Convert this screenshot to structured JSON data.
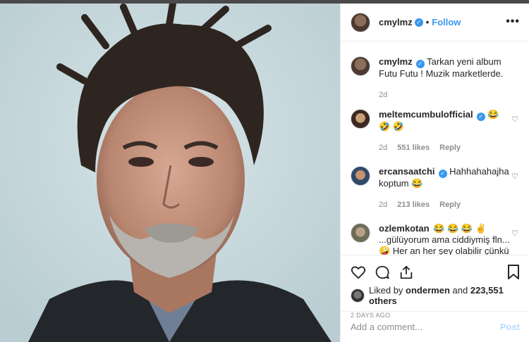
{
  "colors": {
    "accent": "#3897f0",
    "text": "#262626",
    "muted": "#8e8e8e",
    "post_disabled": "#b3dbff"
  },
  "photo": {
    "icon": "portrait-photo"
  },
  "header": {
    "username": "cmylmz",
    "follow_label": "Follow",
    "more_icon": "more-horizontal-icon"
  },
  "caption": {
    "username": "cmylmz",
    "text": "Tarkan yeni album Futu Futu ! Muzik marketlerde.",
    "time": "2d"
  },
  "comments": [
    {
      "username": "meltemcumbulofficial",
      "text": "😂 🤣 🤣",
      "time": "2d",
      "likes": "551 likes",
      "reply": "Reply"
    },
    {
      "username": "ercansaatchi",
      "text": "Hahhahahajha koptum 😂",
      "time": "2d",
      "likes": "213 likes",
      "reply": "Reply"
    },
    {
      "username": "ozlemkotan",
      "text": "😂 😂 😂 ✌️ ...gülüyorum ama ciddiymiş fln... 🤪  Her an her şey olabilir çünkü bizde💕"
    }
  ],
  "actions": {
    "like_icon": "heart-icon",
    "comment_icon": "comment-icon",
    "share_icon": "share-icon",
    "save_icon": "bookmark-icon"
  },
  "likes": {
    "prefix": "Liked by",
    "user": "ondermen",
    "joiner": "and",
    "count": "223,551 others"
  },
  "timestamp": "2 DAYS AGO",
  "add_comment": {
    "placeholder": "Add a comment...",
    "post_label": "Post"
  }
}
